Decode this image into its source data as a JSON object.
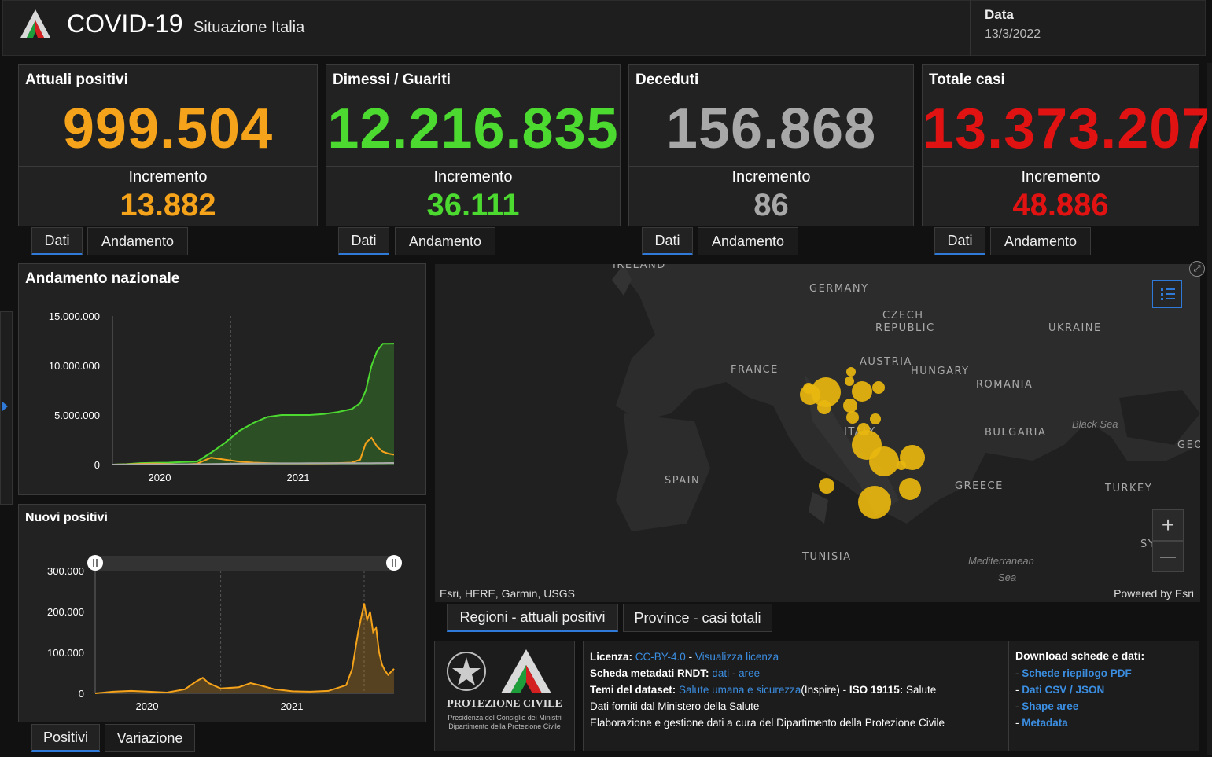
{
  "header": {
    "title": "COVID-19",
    "subtitle": "Situazione Italia",
    "date_label": "Data",
    "date_value": "13/3/2022"
  },
  "cards": [
    {
      "title": "Attuali positivi",
      "value": "999.504",
      "increment_label": "Incremento",
      "increment": "13.882",
      "color": "#f5a31a"
    },
    {
      "title": "Dimessi / Guariti",
      "value": "12.216.835",
      "increment_label": "Incremento",
      "increment": "36.111",
      "color": "#4cd930"
    },
    {
      "title": "Deceduti",
      "value": "156.868",
      "increment_label": "Incremento",
      "increment": "86",
      "color": "#a8a8a8"
    },
    {
      "title": "Totale casi",
      "value": "13.373.207",
      "increment_label": "Incremento",
      "increment": "48.886",
      "color": "#e01212"
    }
  ],
  "card_tabs": {
    "dati": "Dati",
    "andamento": "Andamento"
  },
  "national_chart": {
    "title": "Andamento nazionale",
    "y_ticks": [
      "15.000.000",
      "10.000.000",
      "5.000.000",
      "0"
    ],
    "x_ticks": [
      "2020",
      "2021"
    ]
  },
  "new_chart": {
    "title": "Nuovi positivi",
    "y_ticks": [
      "300.000",
      "200.000",
      "100.000",
      "0"
    ],
    "x_ticks": [
      "2020",
      "2021"
    ]
  },
  "bottom_tabs": {
    "positivi": "Positivi",
    "variazione": "Variazione"
  },
  "chart_data": [
    {
      "type": "area",
      "title": "Andamento nazionale",
      "ylim": [
        0,
        15000000
      ],
      "x_labels": [
        "2020",
        "2021"
      ],
      "x": [
        0,
        0.05,
        0.1,
        0.15,
        0.2,
        0.25,
        0.3,
        0.35,
        0.4,
        0.45,
        0.5,
        0.55,
        0.6,
        0.65,
        0.7,
        0.75,
        0.8,
        0.85,
        0.88,
        0.9,
        0.92,
        0.94,
        0.96,
        0.98,
        1.0
      ],
      "series": [
        {
          "color": "#4cd930",
          "values": [
            0,
            50000,
            150000,
            180000,
            200000,
            250000,
            300000,
            1200000,
            2200000,
            3400000,
            4200000,
            4800000,
            5000000,
            5000000,
            5000000,
            5100000,
            5300000,
            5600000,
            6200000,
            7500000,
            10000000,
            11500000,
            12200000,
            12200000,
            12216835
          ]
        },
        {
          "color": "#f5a31a",
          "values": [
            0,
            20000,
            80000,
            100000,
            60000,
            20000,
            80000,
            700000,
            500000,
            300000,
            200000,
            150000,
            120000,
            120000,
            120000,
            130000,
            150000,
            200000,
            500000,
            2200000,
            2700000,
            1800000,
            1300000,
            1100000,
            999504
          ]
        },
        {
          "color": "#a8a8a8",
          "values": [
            0,
            5000,
            20000,
            30000,
            35000,
            36000,
            40000,
            60000,
            80000,
            100000,
            110000,
            120000,
            127000,
            130000,
            131000,
            132000,
            133000,
            134000,
            138000,
            142000,
            146000,
            150000,
            153000,
            155000,
            156868
          ]
        }
      ]
    },
    {
      "type": "area",
      "title": "Nuovi positivi",
      "ylim": [
        0,
        300000
      ],
      "x_labels": [
        "2020",
        "2021"
      ],
      "x": [
        0,
        0.06,
        0.12,
        0.18,
        0.24,
        0.3,
        0.34,
        0.36,
        0.38,
        0.42,
        0.48,
        0.52,
        0.55,
        0.6,
        0.66,
        0.72,
        0.78,
        0.84,
        0.86,
        0.88,
        0.9,
        0.91,
        0.92,
        0.93,
        0.94,
        0.95,
        0.96,
        0.97,
        0.98,
        1.0
      ],
      "series": [
        {
          "color": "#f5a31a",
          "values": [
            0,
            4000,
            6000,
            4000,
            2000,
            10000,
            30000,
            38000,
            25000,
            12000,
            15000,
            25000,
            20000,
            10000,
            5000,
            4000,
            6000,
            20000,
            60000,
            150000,
            220000,
            180000,
            200000,
            150000,
            160000,
            100000,
            70000,
            55000,
            45000,
            60000
          ]
        }
      ]
    }
  ],
  "map": {
    "labels": [
      "GERMANY",
      "CZECH",
      "REPUBLIC",
      "UKRAINE",
      "FRANCE",
      "AUSTRIA",
      "HUNGARY",
      "ROMANIA",
      "BULGARIA",
      "ITALY",
      "SPAIN",
      "GREECE",
      "TURKEY",
      "TUNISIA",
      "IRELAND",
      "GEO",
      "SY"
    ],
    "seas": [
      "Black Sea",
      "Mediterranean",
      "Sea"
    ],
    "attribution": "Esri, HERE, Garmin, USGS",
    "powered": "Powered by Esri",
    "zoom_in": "+",
    "zoom_out": "—"
  },
  "map_tabs": {
    "regioni": "Regioni - attuali positivi",
    "province": "Province - casi totali"
  },
  "footer": {
    "org_name": "PROTEZIONE CIVILE",
    "org_sub1": "Presidenza del Consiglio dei Ministri",
    "org_sub2": "Dipartimento della Protezione Civile",
    "licenza_label": "Licenza:",
    "licenza_value": "CC-BY-4.0",
    "licenza_sep": " - ",
    "licenza_link": "Visualizza licenza",
    "scheda_label": "Scheda metadati RNDT:",
    "scheda_link1": "dati",
    "scheda_sep": " - ",
    "scheda_link2": "aree",
    "temi_label": "Temi del dataset:",
    "temi_link": "Salute umana e sicurezza",
    "temi_inspire": "(Inspire) - ",
    "temi_iso_label": "ISO 19115:",
    "temi_iso_value": " Salute",
    "dati_forniti": "Dati forniti dal Ministero della Salute",
    "elaborazione": "Elaborazione e gestione dati a cura del Dipartimento della Protezione Civile",
    "download_title": "Download schede e dati:",
    "downloads": [
      "Schede riepilogo PDF",
      "Dati CSV / JSON",
      "Shape aree",
      "Metadata"
    ]
  }
}
